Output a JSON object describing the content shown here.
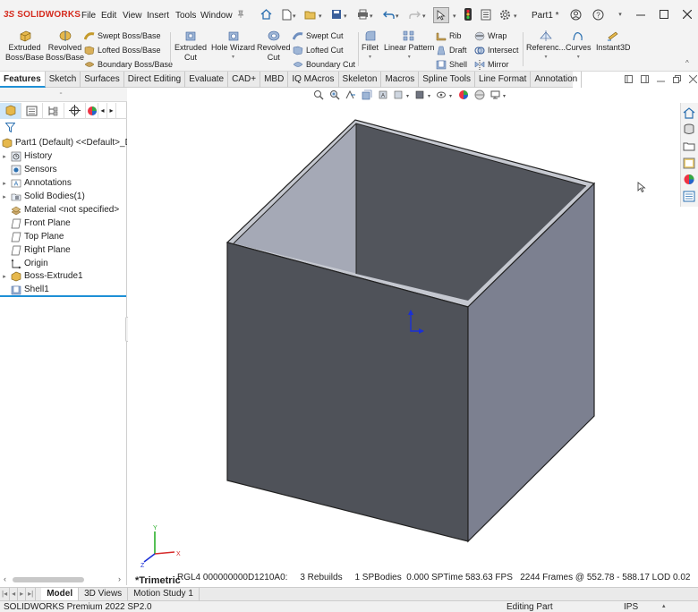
{
  "app": {
    "brand_ds": "3S",
    "brand_name": "SOLIDWORKS",
    "document_name": "Part1 *"
  },
  "menu": [
    "File",
    "Edit",
    "View",
    "Insert",
    "Tools",
    "Window"
  ],
  "ribbon": {
    "extruded_boss": [
      "Extruded",
      "Boss/Base"
    ],
    "revolved_boss": [
      "Revolved",
      "Boss/Base"
    ],
    "swept_boss": "Swept Boss/Base",
    "lofted_boss": "Lofted Boss/Base",
    "boundary_boss": "Boundary Boss/Base",
    "extruded_cut": [
      "Extruded",
      "Cut"
    ],
    "hole_wizard": "Hole Wizard",
    "revolved_cut": [
      "Revolved",
      "Cut"
    ],
    "swept_cut": "Swept Cut",
    "lofted_cut": "Lofted Cut",
    "boundary_cut": "Boundary Cut",
    "fillet": "Fillet",
    "linear_pattern": "Linear Pattern",
    "rib": "Rib",
    "draft": "Draft",
    "shell": "Shell",
    "wrap": "Wrap",
    "intersect": "Intersect",
    "mirror": "Mirror",
    "reference": "Referenc...",
    "curves": "Curves",
    "instant3d": "Instant3D"
  },
  "tabs": [
    "Features",
    "Sketch",
    "Surfaces",
    "Direct Editing",
    "Evaluate",
    "CAD+",
    "MBD",
    "IQ MAcros",
    "Skeleton",
    "Macros",
    "Spline Tools",
    "Line Format",
    "Annotation"
  ],
  "tree": {
    "root": "Part1 (Default) <<Default>_Di",
    "items": [
      {
        "label": "History",
        "expand": true
      },
      {
        "label": "Sensors",
        "expand": false
      },
      {
        "label": "Annotations",
        "expand": true
      },
      {
        "label": "Solid Bodies(1)",
        "expand": true
      },
      {
        "label": "Material <not specified>",
        "expand": false
      },
      {
        "label": "Front Plane",
        "expand": false
      },
      {
        "label": "Top Plane",
        "expand": false
      },
      {
        "label": "Right Plane",
        "expand": false
      },
      {
        "label": "Origin",
        "expand": false
      },
      {
        "label": "Boss-Extrude1",
        "expand": true
      },
      {
        "label": "Shell1",
        "expand": false
      }
    ]
  },
  "viewport": {
    "view_name": "*Trimetric",
    "triad_x": "X",
    "triad_y": "Y",
    "triad_z": "Z",
    "status_text": "RGL4 000000000D1210A0:     3 Rebuilds     1 SPBodies  0.000 SPTime 583.63 FPS   2244 Frames @ 552.78 - 588.17 LOD 0.02"
  },
  "bottom_tabs": [
    "Model",
    "3D Views",
    "Motion Study 1"
  ],
  "statusbar": {
    "product": "SOLIDWORKS Premium 2022 SP2.0",
    "mode": "Editing Part",
    "units": "IPS"
  },
  "colors": {
    "accent": "#1e90d6",
    "brand": "#d52b1e",
    "box_front": "#4f5259",
    "box_right": "#7c8090",
    "box_inner_back": "#52555c",
    "box_inner_left": "#a5a9b6",
    "box_rim": "#c5c8d0"
  }
}
